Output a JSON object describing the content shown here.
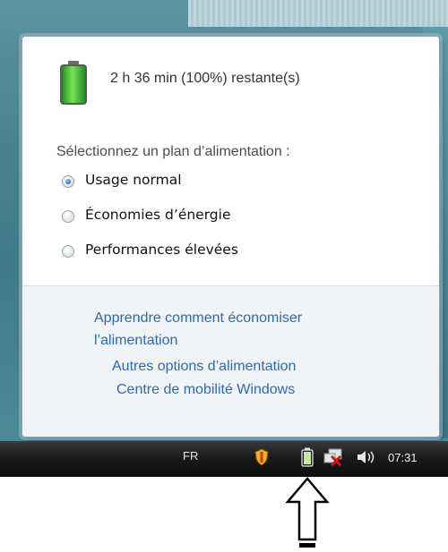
{
  "flyout": {
    "battery_status": "2 h 36 min (100%) restante(s)",
    "plan_title": "Sélectionnez un plan d’alimentation :",
    "plans": [
      {
        "label": "Usage normal",
        "selected": true
      },
      {
        "label": "Économies d’énergie",
        "selected": false
      },
      {
        "label": "Performances élevées",
        "selected": false
      }
    ],
    "links": {
      "learn_line1": "Apprendre comment économiser",
      "learn_line2": "l’alimentation",
      "more_options": "Autres options d’alimentation",
      "mobility_center": "Centre de mobilité Windows"
    }
  },
  "taskbar": {
    "language": "FR",
    "clock": "07:31",
    "icons": [
      "shield-icon",
      "battery-icon",
      "network-disconnected-icon",
      "volume-icon"
    ]
  },
  "colors": {
    "link": "#2e6ab0",
    "taskbar": "#1a1a1a",
    "battery_green": "#3fbf2f"
  }
}
